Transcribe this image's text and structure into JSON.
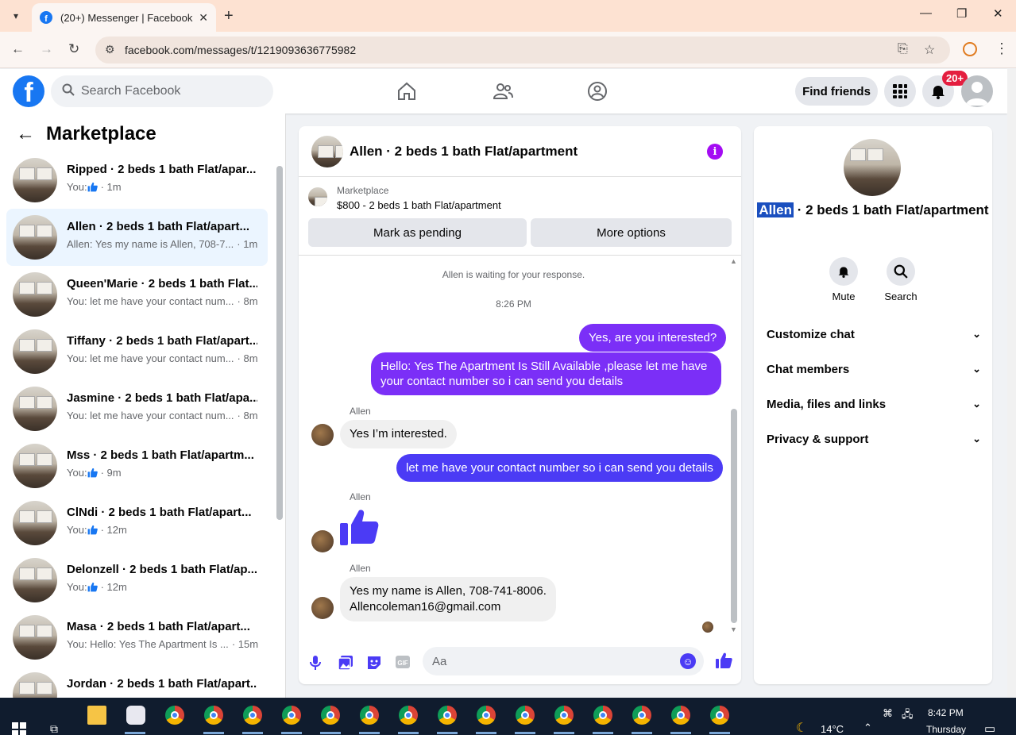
{
  "browser": {
    "tab_title": "(20+) Messenger | Facebook",
    "url": "facebook.com/messages/t/1219093636775982"
  },
  "fb": {
    "search_placeholder": "Search Facebook",
    "find_friends": "Find friends",
    "notif_badge": "20+"
  },
  "marketplace": {
    "title": "Marketplace",
    "conversations": [
      {
        "name": "Ripped · 2 beds 1 bath Flat/apar...",
        "sub_prefix": "You:",
        "like": true,
        "sub": "",
        "time": "· 1m",
        "active": false
      },
      {
        "name": "Allen · 2 beds 1 bath Flat/apart...",
        "sub_prefix": "",
        "like": false,
        "sub": "Allen: Yes my name is Allen, 708-7...",
        "time": "· 1m",
        "active": true
      },
      {
        "name": "Queen'Marie · 2 beds 1 bath Flat...",
        "sub_prefix": "",
        "like": false,
        "sub": "You: let me have your contact num...",
        "time": "· 8m",
        "active": false
      },
      {
        "name": "Tiffany · 2 beds 1 bath Flat/apart...",
        "sub_prefix": "",
        "like": false,
        "sub": "You: let me have your contact num...",
        "time": "· 8m",
        "active": false
      },
      {
        "name": "Jasmine · 2 beds 1 bath Flat/apa...",
        "sub_prefix": "",
        "like": false,
        "sub": "You: let me have your contact num...",
        "time": "· 8m",
        "active": false
      },
      {
        "name": "Mss · 2 beds 1 bath Flat/apartm...",
        "sub_prefix": "You:",
        "like": true,
        "sub": "",
        "time": "· 9m",
        "active": false
      },
      {
        "name": "ClNdi · 2 beds 1 bath Flat/apart...",
        "sub_prefix": "You:",
        "like": true,
        "sub": "",
        "time": "· 12m",
        "active": false
      },
      {
        "name": "Delonzell · 2 beds 1 bath Flat/ap...",
        "sub_prefix": "You:",
        "like": true,
        "sub": "",
        "time": "· 12m",
        "active": false
      },
      {
        "name": "Masa · 2 beds 1 bath Flat/apart...",
        "sub_prefix": "",
        "like": false,
        "sub": "You: Hello: Yes The Apartment Is ...",
        "time": "· 15m",
        "active": false
      },
      {
        "name": "Jordan · 2 beds 1 bath Flat/apart...",
        "sub_prefix": "",
        "like": false,
        "sub": "",
        "time": "",
        "active": false
      }
    ]
  },
  "chat": {
    "header_name": "Allen · 2 beds 1 bath Flat/apartment",
    "marketplace_label": "Marketplace",
    "listing": "$800 - 2 beds 1 bath Flat/apartment",
    "mark_pending": "Mark as pending",
    "more_options": "More options",
    "waiting": "Allen is waiting for your response.",
    "time": "8:26 PM",
    "out1": "Yes, are you interested?",
    "out2": "Hello: Yes The Apartment Is Still Available ,please let me have your contact number so i can send you details",
    "sender": "Allen",
    "in1": "Yes I’m interested.",
    "out3": "let me have your contact number so i can send you details",
    "in3_line1": "Yes my name is Allen, 708-741-8006.",
    "in3_line2": "Allencoleman16@gmail.com",
    "composer_placeholder": "Aa"
  },
  "info": {
    "name_highlight": "Allen",
    "name_rest": " · 2 beds 1 bath Flat/apartment",
    "mute": "Mute",
    "search": "Search",
    "sections": [
      "Customize chat",
      "Chat members",
      "Media, files and links",
      "Privacy & support"
    ]
  },
  "taskbar": {
    "time": "8:42 PM",
    "day": "Thursday",
    "temp": "14°C"
  },
  "colors": {
    "fb_blue": "#1877f2",
    "outgoing_purple": "#7b2ff7",
    "outgoing_blue": "#4b3bf5",
    "info_purple": "#a40cf3"
  },
  "icons": [
    "search-icon",
    "home-icon",
    "friends-icon",
    "groups-icon",
    "menu-grid-icon",
    "bell-icon",
    "info-icon",
    "mic-icon",
    "photo-icon",
    "sticker-icon",
    "gif-icon",
    "emoji-icon",
    "like-icon",
    "chevron-down-icon"
  ]
}
